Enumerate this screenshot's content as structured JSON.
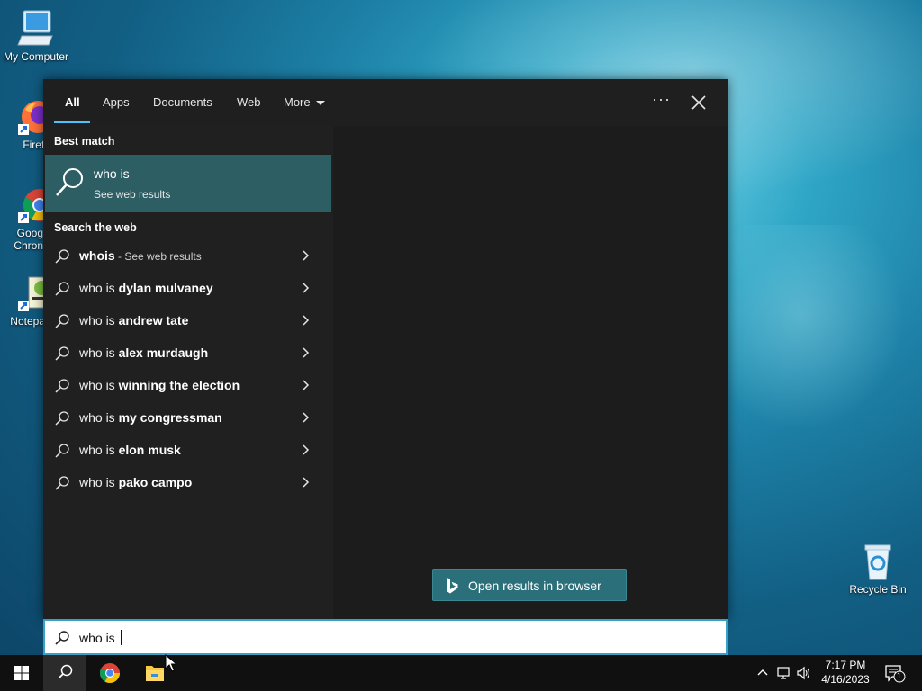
{
  "desktop": {
    "icons": [
      {
        "label": "My Computer",
        "icon": "computer-icon"
      },
      {
        "label": "Firefo",
        "icon": "firefox-icon"
      },
      {
        "label": "Goog",
        "label2": "Chron",
        "icon": "chrome-icon"
      },
      {
        "label": "Notepa",
        "icon": "notepad-icon"
      },
      {
        "label": "Recycle Bin",
        "icon": "recycle-bin-icon"
      }
    ]
  },
  "search_panel": {
    "tabs": [
      {
        "label": "All",
        "active": true
      },
      {
        "label": "Apps"
      },
      {
        "label": "Documents"
      },
      {
        "label": "Web"
      },
      {
        "label": "More"
      }
    ],
    "more_options": "···",
    "best_match_title": "Best match",
    "best_match": {
      "title": "who is",
      "subtitle": "See web results"
    },
    "search_web_title": "Search the web",
    "suggestions": [
      {
        "prefix": "",
        "bold": "whois",
        "suffix": " - See web results"
      },
      {
        "prefix": "who is ",
        "bold": "dylan mulvaney",
        "suffix": ""
      },
      {
        "prefix": "who is ",
        "bold": "andrew tate",
        "suffix": ""
      },
      {
        "prefix": "who is ",
        "bold": "alex murdaugh",
        "suffix": ""
      },
      {
        "prefix": "who is ",
        "bold": "winning the election",
        "suffix": ""
      },
      {
        "prefix": "who is ",
        "bold": "my congressman",
        "suffix": ""
      },
      {
        "prefix": "who is ",
        "bold": "elon musk",
        "suffix": ""
      },
      {
        "prefix": "who is ",
        "bold": "pako campo",
        "suffix": ""
      }
    ],
    "open_browser_label": "Open results in browser"
  },
  "searchbox": {
    "value": "who is "
  },
  "taskbar": {
    "apps": [
      "start-icon",
      "search-icon",
      "chrome-icon",
      "file-explorer-icon"
    ],
    "time": "7:17 PM",
    "date": "4/16/2023",
    "notification_count": "1"
  },
  "colors": {
    "panel_bg": "#202020",
    "accent": "#4cc2ff",
    "best_match_bg": "#2d5e64",
    "open_button_bg": "#2a6f7a"
  }
}
